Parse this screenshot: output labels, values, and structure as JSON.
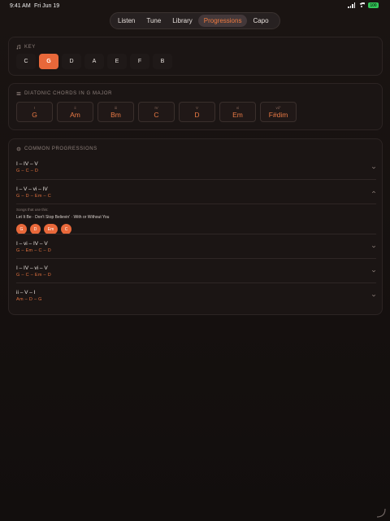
{
  "status": {
    "time": "9:41 AM",
    "date": "Fri Jun 19",
    "battery": "100"
  },
  "nav": [
    {
      "label": "Listen",
      "active": false
    },
    {
      "label": "Tune",
      "active": false
    },
    {
      "label": "Library",
      "active": false
    },
    {
      "label": "Progressions",
      "active": true
    },
    {
      "label": "Capo",
      "active": false
    }
  ],
  "key_card": {
    "title": "KEY",
    "keys": [
      "C",
      "G",
      "D",
      "A",
      "E",
      "F",
      "B"
    ],
    "selected": "G"
  },
  "chords_card": {
    "title": "DIATONIC CHORDS IN G MAJOR",
    "chords": [
      {
        "numeral": "I",
        "name": "G"
      },
      {
        "numeral": "ii",
        "name": "Am"
      },
      {
        "numeral": "iii",
        "name": "Bm"
      },
      {
        "numeral": "IV",
        "name": "C"
      },
      {
        "numeral": "V",
        "name": "D"
      },
      {
        "numeral": "vi",
        "name": "Em"
      },
      {
        "numeral": "vii°",
        "name": "F#dim"
      }
    ]
  },
  "progressions_card": {
    "title": "COMMON PROGRESSIONS",
    "items": [
      {
        "name": "I – IV – V",
        "chords": "G – C – D",
        "expanded": false
      },
      {
        "name": "I – V – vi – IV",
        "chords": "G – D – Em – C",
        "expanded": true,
        "songs_label": "Songs that use this:",
        "songs": "Let It Be · Don't Stop Believin' · With or Without You",
        "pills": [
          "G",
          "D",
          "Em",
          "C"
        ]
      },
      {
        "name": "I – vi – IV – V",
        "chords": "G – Em – C – D",
        "expanded": false
      },
      {
        "name": "I – IV – vi – V",
        "chords": "G – C – Em – D",
        "expanded": false
      },
      {
        "name": "ii – V – I",
        "chords": "Am – D – G",
        "expanded": false
      }
    ]
  },
  "colors": {
    "accent": "#e8683a",
    "background": "#151010",
    "card": "#1b1514"
  }
}
